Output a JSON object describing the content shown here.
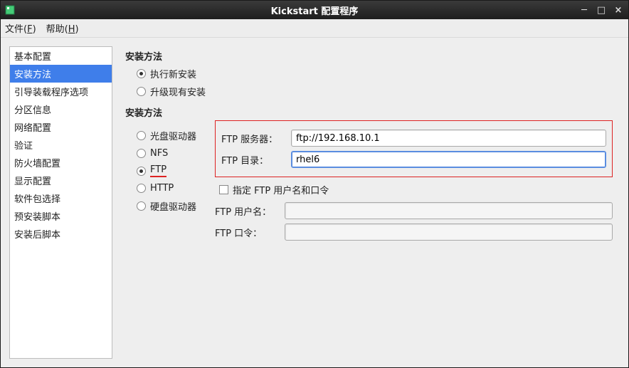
{
  "window": {
    "title": "Kickstart 配置程序"
  },
  "menubar": {
    "file": {
      "label": "文件",
      "mnemonic": "F"
    },
    "help": {
      "label": "帮助",
      "mnemonic": "H"
    }
  },
  "sidebar": {
    "items": [
      {
        "label": "基本配置"
      },
      {
        "label": "安装方法"
      },
      {
        "label": "引导装载程序选项"
      },
      {
        "label": "分区信息"
      },
      {
        "label": "网络配置"
      },
      {
        "label": "验证"
      },
      {
        "label": "防火墙配置"
      },
      {
        "label": "显示配置"
      },
      {
        "label": "软件包选择"
      },
      {
        "label": "预安装脚本"
      },
      {
        "label": "安装后脚本"
      }
    ],
    "selected_index": 1
  },
  "main": {
    "install_method_heading": "安装方法",
    "install_type": {
      "fresh": "执行新安装",
      "upgrade": "升级现有安装",
      "selected": "fresh"
    },
    "source_heading": "安装方法",
    "sources": {
      "cdrom": "光盘驱动器",
      "nfs": "NFS",
      "ftp": "FTP",
      "http": "HTTP",
      "hdd": "硬盘驱动器",
      "selected": "ftp"
    },
    "ftp": {
      "server_label": "FTP 服务器：",
      "server_value": "ftp://192.168.10.1",
      "dir_label": "FTP 目录：",
      "dir_value": "rhel6",
      "specify_creds_label": "指定 FTP 用户名和口令",
      "specify_creds_checked": false,
      "user_label": "FTP 用户名：",
      "user_value": "",
      "pass_label": "FTP 口令：",
      "pass_value": ""
    }
  }
}
